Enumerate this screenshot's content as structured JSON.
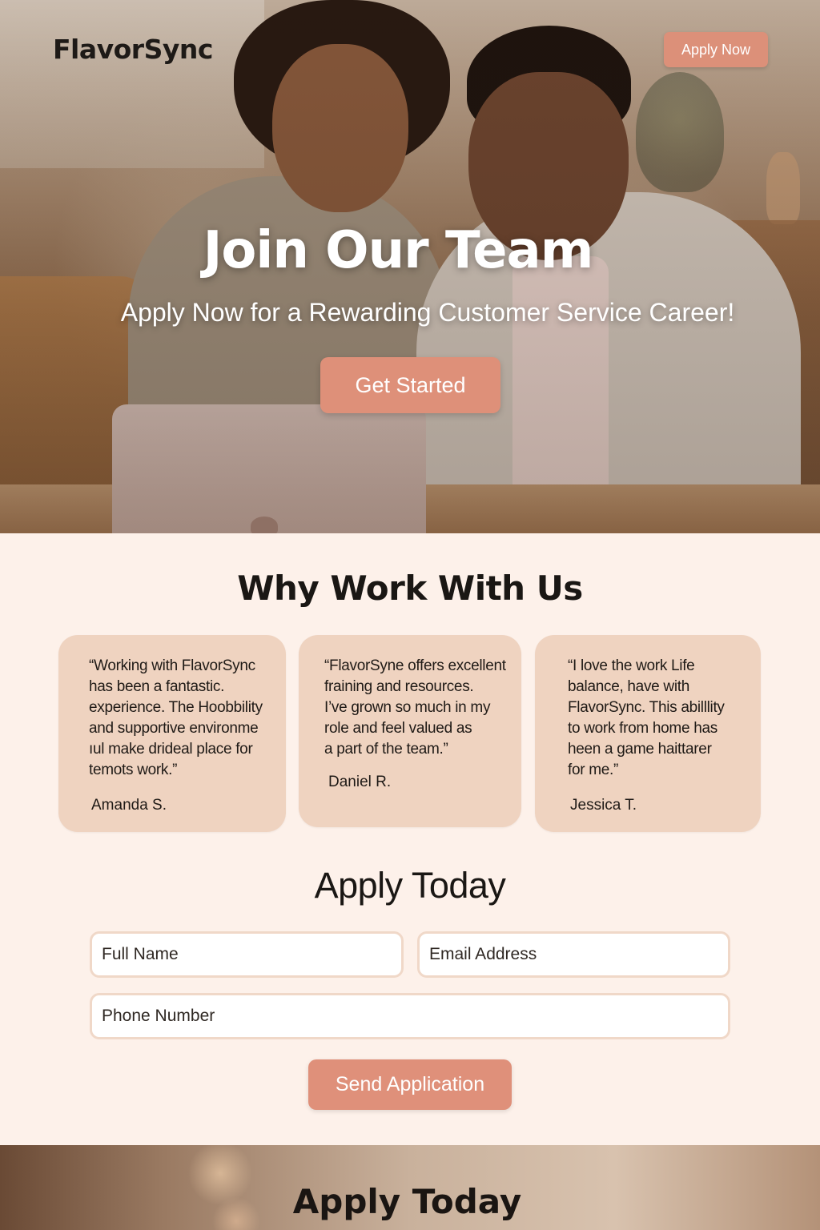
{
  "brand": {
    "logo_text": "FlavorSync"
  },
  "nav": {
    "apply_now_label": "Apply Now"
  },
  "hero": {
    "title": "Join Our Team",
    "subtitle": "Apply Now for a Rewarding Customer Service Career!",
    "cta_label": "Get Started"
  },
  "why": {
    "title": "Why Work With Us",
    "testimonials": [
      {
        "quote": "“Working with FlavorSync\nhas been a fantastic.\nexperience. The Hoobbility\nand supportive environme\nıul make drideal place for\ntemots work.”",
        "author": "Amanda S."
      },
      {
        "quote": "“FlavorSyne offers excellent\nfraining and resources.\nI’ve grown so much in my\nrole and feel valued as\na part of the team.”",
        "author": "Daniel R."
      },
      {
        "quote": "“I love the work Life\nbalance,  have with\nFlavorSync. This abilllity\nto work from home has\nheen a game haittarer\nfor me.”",
        "author": "Jessica T."
      }
    ]
  },
  "apply": {
    "title": "Apply Today",
    "fields": {
      "full_name_placeholder": "Full Name",
      "email_placeholder": "Email Address",
      "phone_placeholder": "Phone Number"
    },
    "submit_label": "Send Application"
  },
  "footer_band": {
    "title": "Apply Today"
  },
  "colors": {
    "accent": "#de9079",
    "page_background": "#fdf1ea",
    "card_background": "#efd3c0",
    "field_border": "#f0d8c8"
  }
}
